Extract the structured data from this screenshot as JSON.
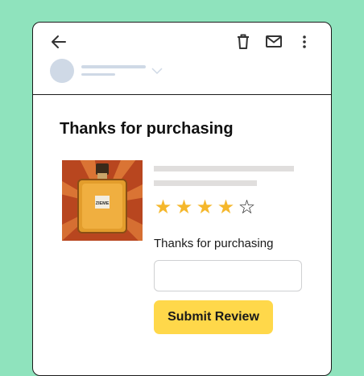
{
  "email": {
    "title": "Thanks for purchasing",
    "product": {
      "bottle_label": "ZIEME",
      "rating": {
        "value": 4,
        "max": 5,
        "full_star": "★",
        "empty_star": "☆"
      }
    },
    "review": {
      "prompt": "Thanks for purchasing",
      "input_value": "",
      "submit_label": "Submit Review"
    }
  },
  "icons": {
    "back": "arrow-left-icon",
    "delete": "trash-icon",
    "mail": "mail-icon",
    "more": "more-vertical-icon",
    "expand": "chevron-down-icon"
  },
  "colors": {
    "background": "#8fe3bd",
    "star": "#f5b72b",
    "button": "#ffd84a",
    "placeholder": "#cfd9e6"
  }
}
